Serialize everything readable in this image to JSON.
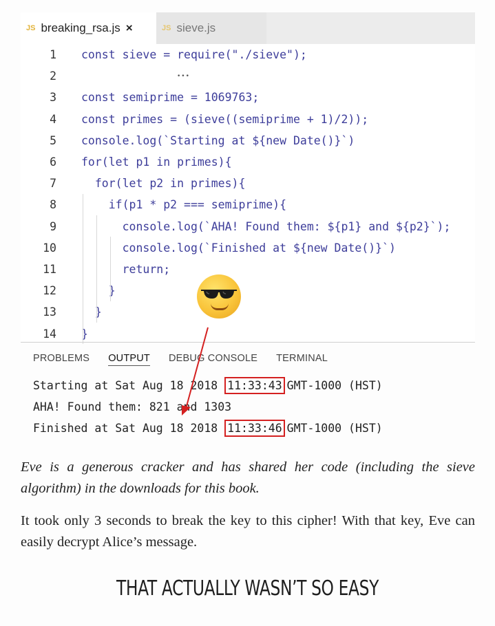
{
  "editor": {
    "tabs": [
      {
        "label": "breaking_rsa.js",
        "icon": "js-file-icon",
        "close": "×",
        "active": true
      },
      {
        "label": "sieve.js",
        "icon": "js-file-icon",
        "active": false
      }
    ],
    "code_lines": [
      {
        "num": "1",
        "text": "const sieve = require(\"./sieve\");"
      },
      {
        "num": "2",
        "text": ""
      },
      {
        "num": "3",
        "text": "const semiprime = 1069763;"
      },
      {
        "num": "4",
        "text": "const primes = (sieve((semiprime + 1)/2));"
      },
      {
        "num": "5",
        "text": "console.log(`Starting at ${new Date()}`)"
      },
      {
        "num": "6",
        "text": "for(let p1 in primes){"
      },
      {
        "num": "7",
        "text": "  for(let p2 in primes){"
      },
      {
        "num": "8",
        "text": "    if(p1 * p2 === semiprime){"
      },
      {
        "num": "9",
        "text": "      console.log(`AHA! Found them: ${p1} and ${p2}`);"
      },
      {
        "num": "10",
        "text": "      console.log(`Finished at ${new Date()}`)"
      },
      {
        "num": "11",
        "text": "      return;"
      },
      {
        "num": "12",
        "text": "    }"
      },
      {
        "num": "13",
        "text": "  }"
      },
      {
        "num": "14",
        "text": "}"
      }
    ],
    "hint_dots": "•••"
  },
  "panel": {
    "tabs": [
      {
        "label": "PROBLEMS",
        "active": false
      },
      {
        "label": "OUTPUT",
        "active": true
      },
      {
        "label": "DEBUG CONSOLE",
        "active": false
      },
      {
        "label": "TERMINAL",
        "active": false
      }
    ],
    "output": {
      "line1_pre": "Starting at Sat Aug 18 2018 ",
      "line1_time": "11:33:43",
      "line1_post": "GMT-1000 (HST)",
      "line2": "AHA! Found them: 821 and 1303",
      "line3_pre": "Finished at Sat Aug 18 2018 ",
      "line3_time": "11:33:46",
      "line3_post": "GMT-1000 (HST)"
    }
  },
  "annotations": {
    "emoji": "smiling-face-with-sunglasses-icon",
    "highlight_color": "#d42020"
  },
  "text": {
    "caption": "Eve is a generous cracker and has shared her code (including the sieve algorithm) in the downloads for this book.",
    "body": "It took only 3 seconds to break the key to this cipher! With that key, Eve can easily decrypt Alice’s message.",
    "heading": "THAT ACTUALLY WASN’T SO EASY"
  }
}
